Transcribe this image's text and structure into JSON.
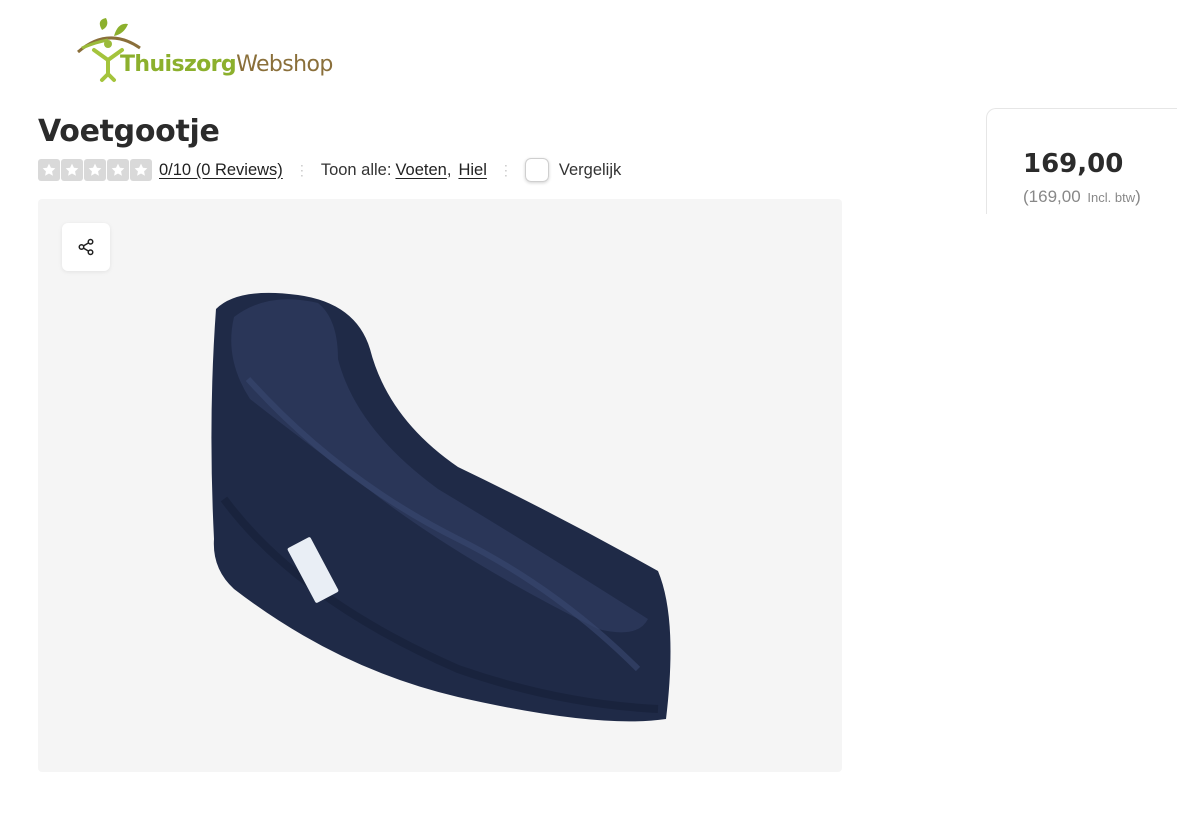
{
  "brand": {
    "logo_part1": "Thuiszorg",
    "logo_part2": "Webshop"
  },
  "product": {
    "title": "Voetgootje",
    "rating_text": "0/10 (0 Reviews)",
    "show_all_label": "Toon alle:",
    "categories": [
      "Voeten",
      "Hiel"
    ],
    "category_separator": ",",
    "compare_label": "Vergelijk",
    "stars": [
      0,
      0,
      0,
      0,
      0
    ]
  },
  "price": {
    "amount": "169,00",
    "incl_open": "(169,00",
    "incl_label": "Incl. btw",
    "incl_close": ")"
  },
  "icons": {
    "share": "share-icon",
    "star": "star-icon"
  },
  "colors": {
    "brand_green": "#8cb02d",
    "brand_brown": "#8a6f3a",
    "star_empty": "#d9d9d9"
  }
}
